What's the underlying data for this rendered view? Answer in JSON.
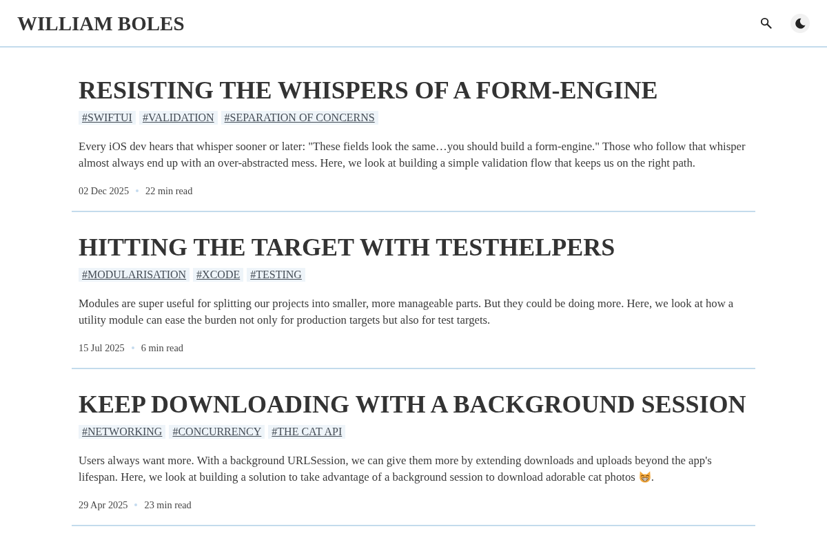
{
  "header": {
    "site_title": "WILLIAM BOLES"
  },
  "posts": [
    {
      "title": "RESISTING THE WHISPERS OF A FORM-ENGINE",
      "tags": [
        "#SWIFTUI",
        "#VALIDATION",
        "#SEPARATION OF CONCERNS"
      ],
      "description": [
        {
          "kind": "text",
          "text": "Every iOS dev hears that whisper sooner or later: \"These fields look the same…you should build a form-engine.\" Those who follow that whisper almost always end up with an over-abstracted mess. Here, we look at building a simple validation flow that keeps us on the right path."
        }
      ],
      "date": "02 Dec 2025",
      "read_time": "22 min read"
    },
    {
      "title": "HITTING THE TARGET WITH TESTHELPERS",
      "tags": [
        "#MODULARISATION",
        "#XCODE",
        "#TESTING"
      ],
      "description": [
        {
          "kind": "text",
          "text": "Modules are super useful for splitting our projects into smaller, more manageable parts. But they could be doing more. Here, we look at how a utility module can ease the burden not only for production targets but also for test targets."
        }
      ],
      "date": "15 Jul 2025",
      "read_time": "6 min read"
    },
    {
      "title": "KEEP DOWNLOADING WITH A BACKGROUND SESSION",
      "tags": [
        "#NETWORKING",
        "#CONCURRENCY",
        "#THE CAT API"
      ],
      "description": [
        {
          "kind": "text",
          "text": "Users always want more. With a background URLSession, we can give them more by extending downloads and uploads beyond the app's lifespan. Here, we look at building a solution to take advantage of a background session to download adorable cat photos"
        },
        {
          "kind": "cat_emoji"
        },
        {
          "kind": "text",
          "text": "."
        }
      ],
      "date": "29 Apr 2025",
      "read_time": "23 min read"
    }
  ]
}
